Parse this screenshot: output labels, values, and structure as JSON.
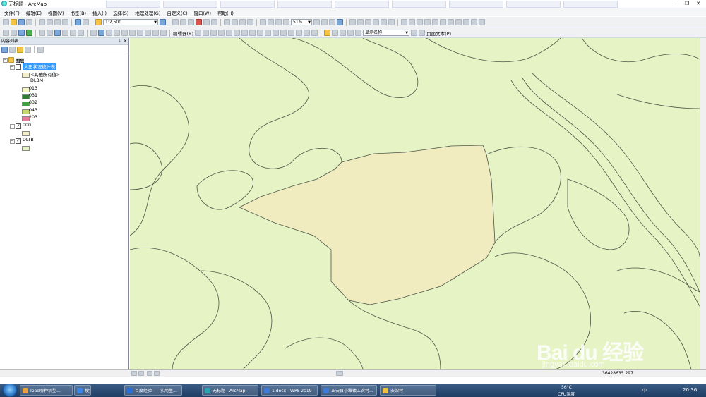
{
  "window": {
    "title": "无标题 - ArcMap"
  },
  "background_tabs": [
    "",
    "",
    "",
    "",
    "",
    "",
    "",
    "",
    ""
  ],
  "menu": [
    "文件(F)",
    "编辑(E)",
    "视图(V)",
    "书签(B)",
    "插入(I)",
    "选择(S)",
    "地理处理(G)",
    "自定义(C)",
    "窗口(W)",
    "帮助(H)"
  ],
  "toolbar": {
    "scale": "1:2,500",
    "zoom": "51%",
    "editor": "编辑器(R)",
    "name_combo": "显示名称",
    "page_text": "页面文本(P)"
  },
  "toc": {
    "title": "内容列表",
    "layers_label": "图层",
    "selected_layer": "大田状况统计表",
    "other_values": "<其他所有值>",
    "field": "DLBM",
    "classes": [
      {
        "label": "013",
        "color": "#f4f7c0"
      },
      {
        "label": "031",
        "color": "#2e7d32"
      },
      {
        "label": "032",
        "color": "#43a047"
      },
      {
        "label": "043",
        "color": "#c5d86d"
      },
      {
        "label": "203",
        "color": "#e57a9a"
      }
    ],
    "layer2": "000",
    "layer3": "DLTB"
  },
  "colors": {
    "map_bg": "#e5f3c5",
    "selected_parcel": "#f0ecc0",
    "lines": "#4d5548"
  },
  "status": {
    "coords": "36428635.297"
  },
  "taskbar": {
    "items": [
      {
        "label": "Ipad哪种机型...",
        "color": "#e8a23a"
      },
      {
        "label": "搜索",
        "color": "#3a86e8"
      },
      {
        "label": "百度经验——实用生...",
        "color": "#2b6fd6"
      },
      {
        "label": "无标题 - ArcMap",
        "color": "#2aa6b0"
      },
      {
        "label": "1.docx - WPS 2019",
        "color": "#3d7bd6"
      },
      {
        "label": "正安县小雅镇工农村...",
        "color": "#3d7bd6"
      },
      {
        "label": "安架村",
        "color": "#f0c040"
      }
    ],
    "temp": "56°C",
    "cpu": "CPU温度",
    "time": "20:36",
    "ime": "中"
  },
  "watermark": {
    "brand": "Bai du 经验",
    "url": "jingyan.baidu.com"
  }
}
